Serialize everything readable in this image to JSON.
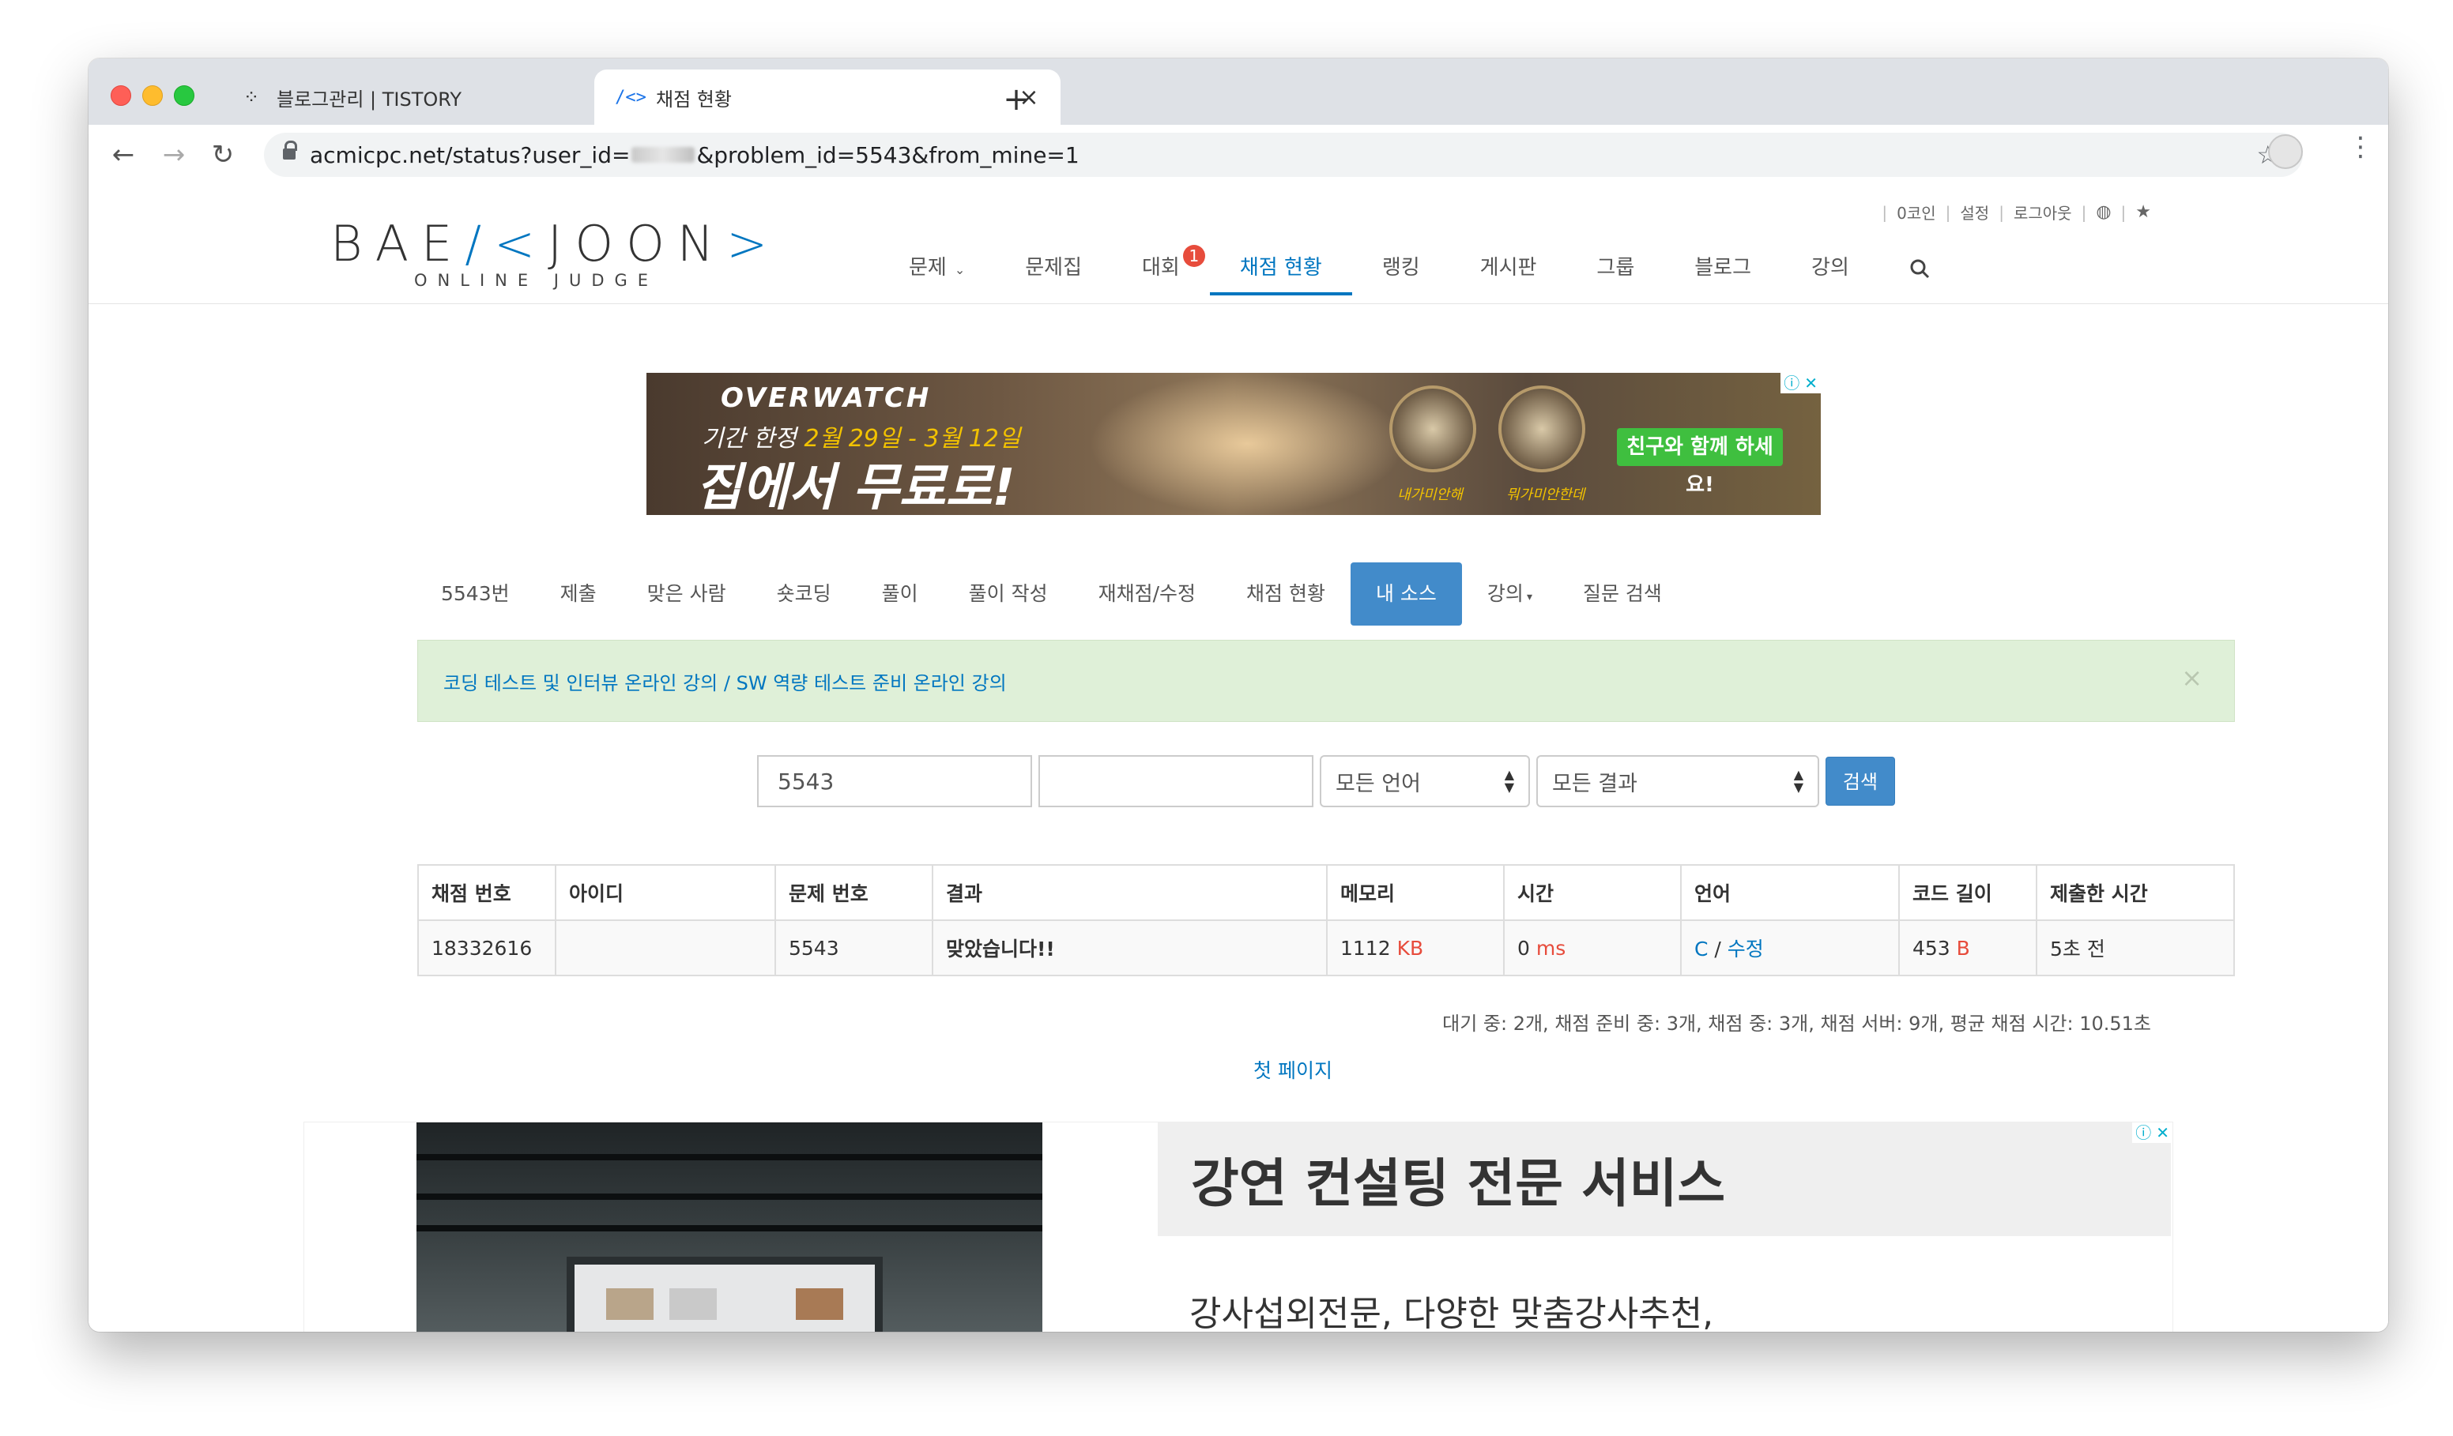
{
  "browser": {
    "tabs": [
      {
        "favicon": "tistory-icon",
        "title": "블로그관리 | TISTORY",
        "active": false
      },
      {
        "favicon": "code-icon",
        "title": "채점 현황",
        "active": true
      }
    ],
    "url_prefix": "acmicpc.net/status?user_id=",
    "url_suffix": "&problem_id=5543&from_mine=1"
  },
  "site": {
    "logo_main_left": "BAE",
    "logo_main_mark": "/<",
    "logo_main_right": "JOON",
    "logo_main_end": ">",
    "logo_sub": "ONLINE JUDGE",
    "user_links": [
      "0코인",
      "설정",
      "로그아웃"
    ],
    "nav": [
      {
        "label": "문제",
        "dropdown": true
      },
      {
        "label": "문제집"
      },
      {
        "label": "대회",
        "badge": "1"
      },
      {
        "label": "채점 현황",
        "active": true
      },
      {
        "label": "랭킹"
      },
      {
        "label": "게시판"
      },
      {
        "label": "그룹"
      },
      {
        "label": "블로그"
      },
      {
        "label": "강의"
      }
    ]
  },
  "ad_top": {
    "brand": "OVERWATCH",
    "period_prefix": "기간 한정 ",
    "period_dates": "2월 29일 - 3월 12일",
    "headline": "집에서 무료로!",
    "medal_captions": [
      "내가미안해",
      "뭐가미안한데"
    ],
    "cta": "친구와 함께 하세요!"
  },
  "problem_menu": [
    {
      "label": "5543번"
    },
    {
      "label": "제출"
    },
    {
      "label": "맞은 사람"
    },
    {
      "label": "숏코딩"
    },
    {
      "label": "풀이"
    },
    {
      "label": "풀이 작성"
    },
    {
      "label": "재채점/수정"
    },
    {
      "label": "채점 현황"
    },
    {
      "label": "내 소스",
      "active": true
    },
    {
      "label": "강의",
      "dropdown": true
    },
    {
      "label": "질문 검색"
    }
  ],
  "alert": {
    "message": "코딩 테스트 및 인터뷰 온라인 강의 / SW 역량 테스트 준비 온라인 강의",
    "close": "×"
  },
  "search_form": {
    "problem_id": "5543",
    "user_id": "",
    "language": "모든 언어",
    "result": "모든 결과",
    "submit": "검색"
  },
  "table": {
    "headers": [
      "채점 번호",
      "아이디",
      "문제 번호",
      "결과",
      "메모리",
      "시간",
      "언어",
      "코드 길이",
      "제출한 시간"
    ],
    "rows": [
      {
        "submission_id": "18332616",
        "user_id": "",
        "problem_id": "5543",
        "result": "맞았습니다!!",
        "memory": "1112",
        "memory_unit": "KB",
        "time": "0",
        "time_unit": "ms",
        "language": "C",
        "language_sep": " / ",
        "edit": "수정",
        "code_length": "453",
        "code_length_unit": "B",
        "submitted": "5초 전"
      }
    ]
  },
  "stats": "대기 중: 2개, 채점 준비 중: 3개, 채점 중: 3개, 채점 서버: 9개, 평균 채점 시간: 10.51초",
  "pagination": {
    "first_page": "첫 페이지"
  },
  "ad_bottom": {
    "headline": "강연 컨설팅 전문 서비스",
    "body": "강사섭외전문, 다양한 맞춤강사추천,"
  },
  "colors": {
    "accent": "#0076c0",
    "primary_button": "#428bca",
    "success": "#009874",
    "unit_red": "#e74c3c",
    "alert_bg": "#dff0d8"
  }
}
